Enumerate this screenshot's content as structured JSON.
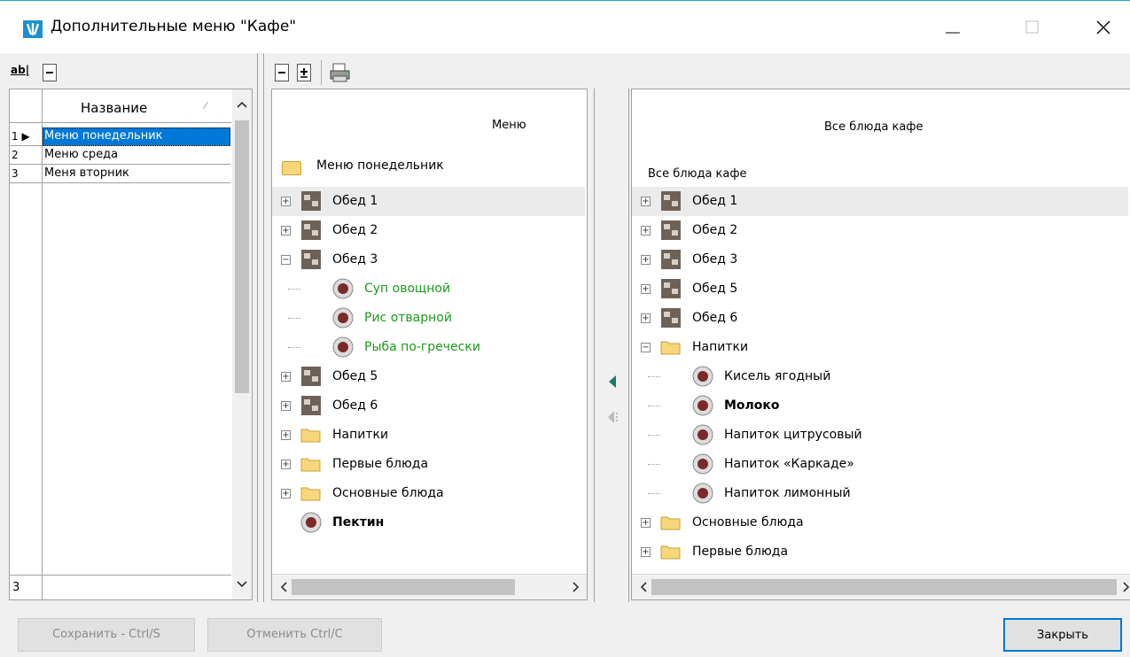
{
  "window": {
    "title": "Дополнительные меню \"Кафе\"",
    "icon_label": "\\|/",
    "minimize": "—",
    "maximize": "☐",
    "close": "✕"
  },
  "left_toolbar": {
    "rename_icon": "ab|",
    "collapse_icon": "−"
  },
  "menu_list": {
    "column_header": "Название",
    "sort_glyph": "⁄",
    "rows": [
      {
        "num": "1",
        "name": "Меню понедельник",
        "selected": true
      },
      {
        "num": "2",
        "name": "Меню среда",
        "selected": false
      },
      {
        "num": "3",
        "name": "Меня вторник",
        "selected": false
      }
    ],
    "footer_num": "3"
  },
  "middle_toolbar": {
    "collapse_icon": "−",
    "expand_icon": "±",
    "print_icon": "printer"
  },
  "menu_tree": {
    "header": "Меню",
    "root_label": "Меню понедельник",
    "items": [
      {
        "label": "Обед 1",
        "icon": "dish-icon",
        "level": 1,
        "expander": "+",
        "style": "normal",
        "highlight": true
      },
      {
        "label": "Обед 2",
        "icon": "dish-icon",
        "level": 1,
        "expander": "+",
        "style": "normal"
      },
      {
        "label": "Обед 3",
        "icon": "dish-icon",
        "level": 1,
        "expander": "−",
        "style": "normal"
      },
      {
        "label": "Суп овощной",
        "icon": "food-icon",
        "level": 2,
        "expander": "",
        "style": "green"
      },
      {
        "label": "Рис отварной",
        "icon": "food-icon",
        "level": 2,
        "expander": "",
        "style": "green"
      },
      {
        "label": "Рыба по-гречески",
        "icon": "food-icon",
        "level": 2,
        "expander": "",
        "style": "green"
      },
      {
        "label": "Обед 5",
        "icon": "dish-icon",
        "level": 1,
        "expander": "+",
        "style": "normal"
      },
      {
        "label": "Обед 6",
        "icon": "dish-icon",
        "level": 1,
        "expander": "+",
        "style": "normal"
      },
      {
        "label": "Напитки",
        "icon": "folder-icon",
        "level": 1,
        "expander": "+",
        "style": "normal"
      },
      {
        "label": "Первые блюда",
        "icon": "folder-icon",
        "level": 1,
        "expander": "+",
        "style": "normal"
      },
      {
        "label": "Основные блюда",
        "icon": "folder-icon",
        "level": 1,
        "expander": "+",
        "style": "normal"
      },
      {
        "label": "Пектин",
        "icon": "food-icon",
        "level": 1,
        "expander": "",
        "style": "bold"
      }
    ]
  },
  "dishes_tree": {
    "header": "Все блюда кафе",
    "root_label": "Все блюда кафе",
    "items": [
      {
        "label": "Обед 1",
        "icon": "dish-icon",
        "level": 1,
        "expander": "+",
        "style": "normal",
        "highlight": true
      },
      {
        "label": "Обед 2",
        "icon": "dish-icon",
        "level": 1,
        "expander": "+",
        "style": "normal"
      },
      {
        "label": "Обед 3",
        "icon": "dish-icon",
        "level": 1,
        "expander": "+",
        "style": "normal"
      },
      {
        "label": "Обед 5",
        "icon": "dish-icon",
        "level": 1,
        "expander": "+",
        "style": "normal"
      },
      {
        "label": "Обед 6",
        "icon": "dish-icon",
        "level": 1,
        "expander": "+",
        "style": "normal"
      },
      {
        "label": "Напитки",
        "icon": "folder-icon",
        "level": 1,
        "expander": "−",
        "style": "normal"
      },
      {
        "label": "Кисель ягодный",
        "icon": "food-icon",
        "level": 2,
        "expander": "",
        "style": "normal"
      },
      {
        "label": "Молоко",
        "icon": "food-icon",
        "level": 2,
        "expander": "",
        "style": "bold"
      },
      {
        "label": "Напиток  цитрусовый",
        "icon": "food-icon",
        "level": 2,
        "expander": "",
        "style": "normal"
      },
      {
        "label": "Напиток «Каркаде»",
        "icon": "food-icon",
        "level": 2,
        "expander": "",
        "style": "normal"
      },
      {
        "label": "Напиток лимонный",
        "icon": "food-icon",
        "level": 2,
        "expander": "",
        "style": "normal"
      },
      {
        "label": "Основные блюда",
        "icon": "folder-icon",
        "level": 1,
        "expander": "+",
        "style": "normal"
      },
      {
        "label": "Первые блюда",
        "icon": "folder-icon",
        "level": 1,
        "expander": "+",
        "style": "normal"
      }
    ]
  },
  "transfer": {
    "add_arrow": "◀",
    "remove_arrow": "◀"
  },
  "buttons": {
    "save": "Сохранить - Ctrl/S",
    "cancel": "Отменить Ctrl/C",
    "close": "Закрыть"
  },
  "colors": {
    "selection": "#0078d7",
    "green_text": "#1a9a1a",
    "accent": "#1ba1e2"
  }
}
